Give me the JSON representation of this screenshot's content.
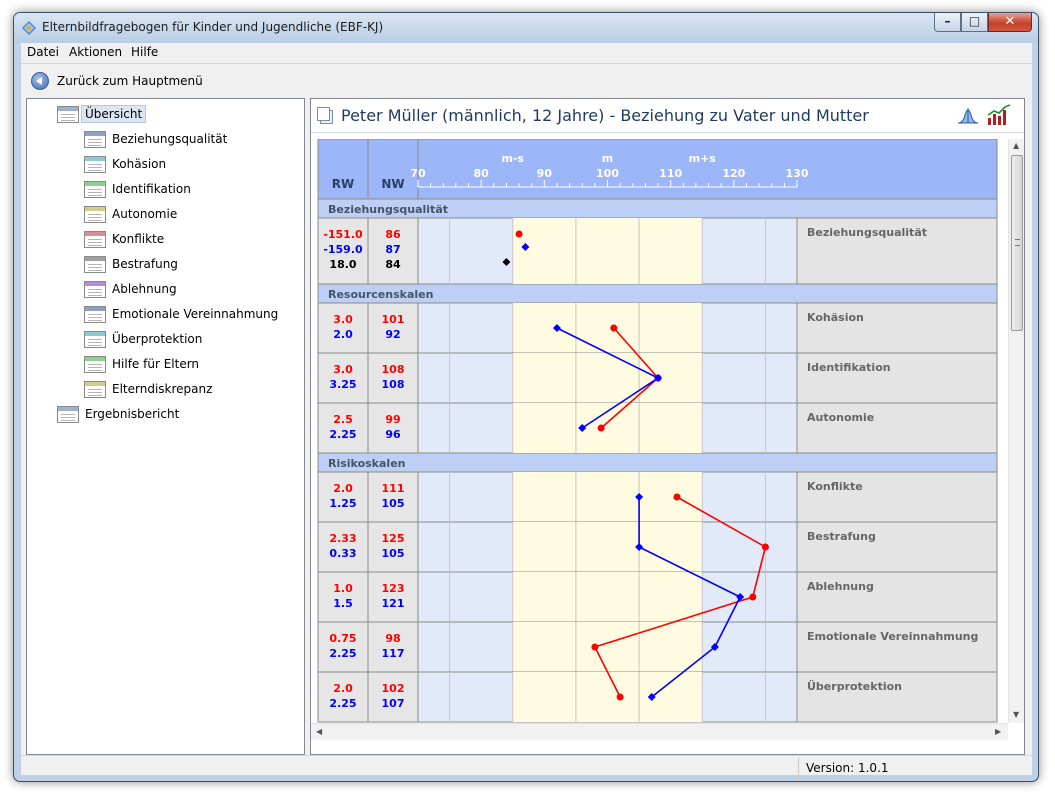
{
  "window": {
    "title": "Elternbildfragebogen für Kinder und Jugendliche (EBF-KJ)"
  },
  "menu": [
    "Datei",
    "Aktionen",
    "Hilfe"
  ],
  "back_button": "Zurück zum Hauptmenü",
  "tree": {
    "root": "Übersicht",
    "children": [
      {
        "label": "Beziehungsqualität",
        "color": "#8f9fc9"
      },
      {
        "label": "Kohäsion",
        "color": "#8ccbd2"
      },
      {
        "label": "Identifikation",
        "color": "#8fd08f"
      },
      {
        "label": "Autonomie",
        "color": "#cfcf8c"
      },
      {
        "label": "Konflikte",
        "color": "#d88f96"
      },
      {
        "label": "Bestrafung",
        "color": "#a0a0a0"
      },
      {
        "label": "Ablehnung",
        "color": "#b48fd0"
      },
      {
        "label": "Emotionale Vereinnahmung",
        "color": "#8f9fc9"
      },
      {
        "label": "Überprotektion",
        "color": "#8ccbd2"
      },
      {
        "label": "Hilfe für Eltern",
        "color": "#8fd08f"
      },
      {
        "label": "Elterndiskrepanz",
        "color": "#cfcf8c"
      }
    ],
    "report": "Ergebnisbericht"
  },
  "profile": {
    "title": "Peter Müller (männlich, 12 Jahre) - Beziehung zu Vater und Mutter",
    "col_rw": "RW",
    "col_nw": "NW",
    "band_labels": {
      "ms": "m-s",
      "m": "m",
      "mps": "m+s"
    },
    "axis_ticks": [
      70,
      80,
      90,
      100,
      110,
      120,
      130
    ],
    "axis_min": 70,
    "axis_max": 130,
    "band_min": 85,
    "band_max": 115,
    "colors": {
      "vater": "#ff0000",
      "mutter": "#0000ff",
      "diff": "#000000",
      "band": "#fffbe0",
      "outer": "#e2e9f9",
      "header": "#9db6f7",
      "section": "#bdcff4"
    },
    "sections": [
      {
        "title": "Beziehungsqualität",
        "rows": [
          {
            "scale": "Beziehungsqualität",
            "triple": true,
            "rw": [
              "-151.0",
              "-159.0",
              "18.0"
            ],
            "nw": [
              "86",
              "87",
              "84"
            ]
          }
        ]
      },
      {
        "title": "Resourcenskalen",
        "rows": [
          {
            "scale": "Kohäsion",
            "rw": [
              "3.0",
              "2.0"
            ],
            "nw": [
              "101",
              "92"
            ]
          },
          {
            "scale": "Identifikation",
            "rw": [
              "3.0",
              "3.25"
            ],
            "nw": [
              "108",
              "108"
            ]
          },
          {
            "scale": "Autonomie",
            "rw": [
              "2.5",
              "2.25"
            ],
            "nw": [
              "99",
              "96"
            ]
          }
        ]
      },
      {
        "title": "Risikoskalen",
        "rows": [
          {
            "scale": "Konflikte",
            "rw": [
              "2.0",
              "1.25"
            ],
            "nw": [
              "111",
              "105"
            ]
          },
          {
            "scale": "Bestrafung",
            "rw": [
              "2.33",
              "0.33"
            ],
            "nw": [
              "125",
              "105"
            ]
          },
          {
            "scale": "Ablehnung",
            "rw": [
              "1.0",
              "1.5"
            ],
            "nw": [
              "123",
              "121"
            ]
          },
          {
            "scale": "Emotionale Vereinnahmung",
            "rw": [
              "0.75",
              "2.25"
            ],
            "nw": [
              "98",
              "117"
            ]
          },
          {
            "scale": "Überprotektion",
            "rw": [
              "2.0",
              "2.25"
            ],
            "nw": [
              "102",
              "107"
            ]
          }
        ]
      }
    ]
  },
  "status": {
    "version": "Version: 1.0.1"
  }
}
